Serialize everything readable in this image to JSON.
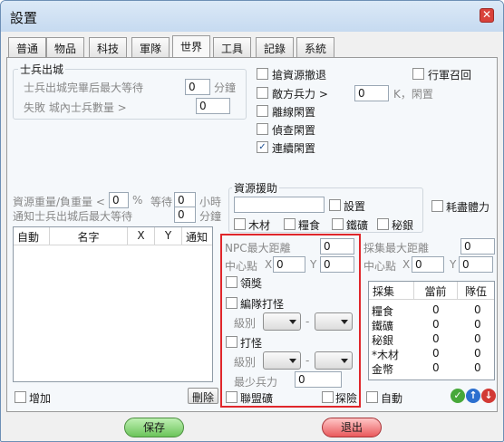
{
  "window": {
    "title": "設置",
    "close_glyph": "✕"
  },
  "tabs": [
    "普通",
    "物品",
    "科技",
    "軍隊",
    "世界",
    "工具",
    "記錄",
    "系統"
  ],
  "soldier": {
    "legend": "士兵出城",
    "wait_label": "士兵出城完畢后最大等待",
    "wait_value": "0",
    "wait_unit": "分鐘",
    "fail_label": "失敗 城內士兵數量 >",
    "fail_value": "0"
  },
  "options": {
    "grab_retreat": "搶資源撤退",
    "march_recall": "行軍召回",
    "enemy_power": "敵方兵力 >",
    "enemy_value": "0",
    "enemy_unit": "K，閑置",
    "offline_idle": "離線閑置",
    "scout_idle": "偵查閑置",
    "continuous_idle": "連續閑置"
  },
  "resource_weight": {
    "label": "資源重量/負重量 <",
    "value": "0",
    "unit": "%",
    "wait_label": "等待",
    "wait_value": "0",
    "wait_unit": "小時",
    "notify_label": "通知士兵出城后最大等待",
    "notify_value": "0",
    "notify_unit": "分鐘"
  },
  "assist": {
    "legend": "資源援助",
    "set_label": "設置",
    "wood": "木材",
    "food": "糧食",
    "iron": "鐵礦",
    "silver": "秘銀",
    "stamina": "耗盡體力"
  },
  "target_list": {
    "headers": [
      "自動",
      "名字",
      "X",
      "Y",
      "通知"
    ],
    "add_label": "增加",
    "delete_label": "刪除"
  },
  "npc": {
    "max_distance_label": "NPC最大距離",
    "max_distance_value": "0",
    "center_label": "中心點",
    "x_label": "X",
    "x_value": "0",
    "y_label": "Y",
    "y_value": "0",
    "reward": "領獎",
    "team_fight": "編隊打怪",
    "level_label": "級別",
    "fight": "打怪",
    "level_label2": "級別",
    "dash": "-",
    "min_power_label": "最少兵力",
    "min_power_value": "0",
    "alliance_mine": "聯盟礦",
    "explore": "探險"
  },
  "gather": {
    "max_distance_label": "採集最大距離",
    "max_distance_value": "0",
    "center_label": "中心點",
    "x_label": "X",
    "x_value": "0",
    "y_label": "Y",
    "y_value": "0",
    "headers": [
      "採集",
      "當前",
      "隊伍"
    ],
    "rows": [
      {
        "name": "糧食",
        "current": "0",
        "team": "0"
      },
      {
        "name": "鐵礦",
        "current": "0",
        "team": "0"
      },
      {
        "name": "秘銀",
        "current": "0",
        "team": "0"
      },
      {
        "name": "*木材",
        "current": "0",
        "team": "0"
      },
      {
        "name": "金幣",
        "current": "0",
        "team": "0"
      }
    ],
    "auto_label": "自動"
  },
  "buttons": {
    "save": "保存",
    "exit": "退出"
  },
  "colors": {
    "highlight_border": "#e0262b",
    "save": "#6cc45b",
    "exit": "#e9595c"
  }
}
